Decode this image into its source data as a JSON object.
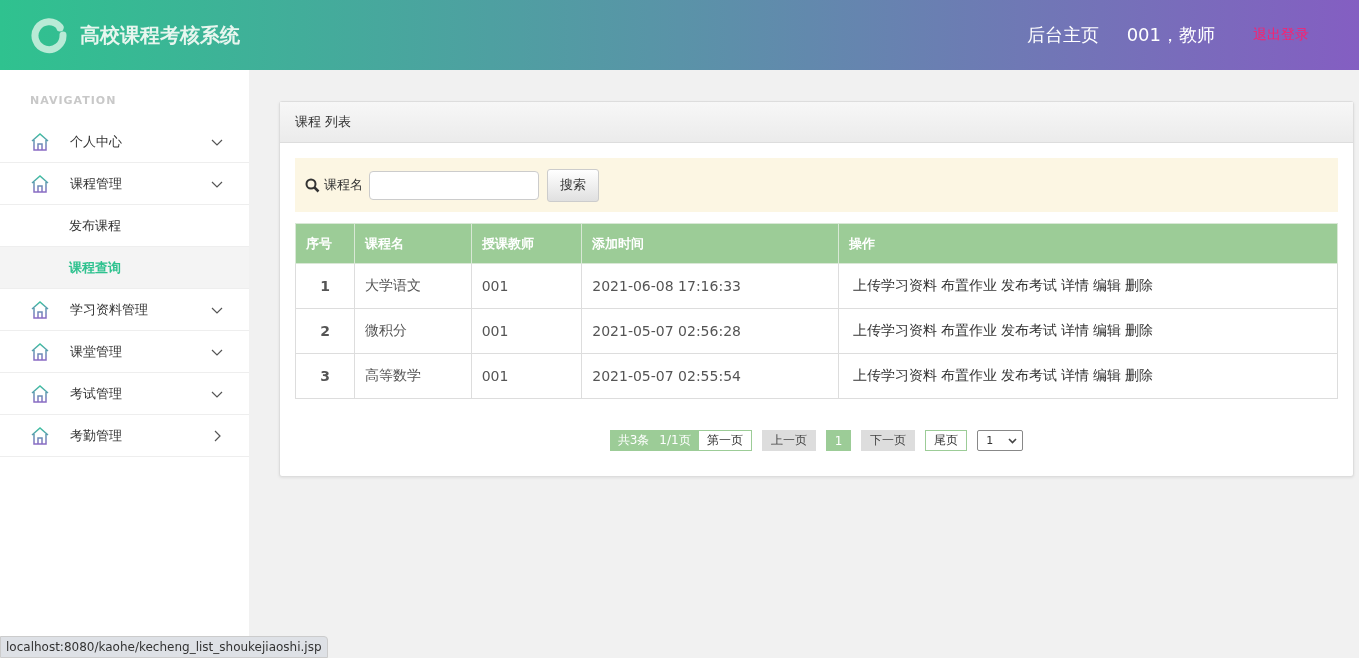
{
  "header": {
    "title": "高校课程考核系统",
    "links": [
      {
        "label": "后台主页"
      },
      {
        "label": "001，教师"
      }
    ],
    "logout": "退出登录"
  },
  "sidebar": {
    "heading": "NAVIGATION",
    "items": [
      {
        "label": "个人中心",
        "expanded": true
      },
      {
        "label": "课程管理",
        "expanded": true,
        "children": [
          {
            "label": "发布课程",
            "selected": false
          },
          {
            "label": "课程查询",
            "selected": true
          }
        ]
      },
      {
        "label": "学习资料管理",
        "expanded": true
      },
      {
        "label": "课堂管理",
        "expanded": true
      },
      {
        "label": "考试管理",
        "expanded": true
      },
      {
        "label": "考勤管理",
        "expanded": false
      }
    ]
  },
  "panel": {
    "title": "课程 列表",
    "search": {
      "label": "课程名",
      "button": "搜索"
    },
    "table": {
      "columns": [
        "序号",
        "课程名",
        "授课教师",
        "添加时间",
        "操作"
      ],
      "rows": [
        {
          "cells": [
            "1",
            "大学语文",
            "001",
            "2021-06-08 17:16:33"
          ],
          "actions": [
            "上传学习资料",
            "布置作业",
            "发布考试",
            "详情",
            "编辑",
            "删除"
          ]
        },
        {
          "cells": [
            "2",
            "微积分",
            "001",
            "2021-05-07 02:56:28"
          ],
          "actions": [
            "上传学习资料",
            "布置作业",
            "发布考试",
            "详情",
            "编辑",
            "删除"
          ]
        },
        {
          "cells": [
            "3",
            "高等数学",
            "001",
            "2021-05-07 02:55:54"
          ],
          "actions": [
            "上传学习资料",
            "布置作业",
            "发布考试",
            "详情",
            "编辑",
            "删除"
          ]
        }
      ]
    },
    "pagination": {
      "total": "共3条",
      "pages": "1/1页",
      "buttons": [
        {
          "label": "第一页",
          "disabled": false
        },
        {
          "label": "上一页",
          "disabled": true
        },
        {
          "label": "1",
          "selected": true,
          "kind": "page"
        },
        {
          "label": "下一页",
          "disabled": true
        },
        {
          "label": "尾页",
          "disabled": false
        }
      ],
      "select": "1"
    }
  },
  "status_bar": "localhost:8080/kaohe/kecheng_list_shoukejiaoshi.jsp"
}
